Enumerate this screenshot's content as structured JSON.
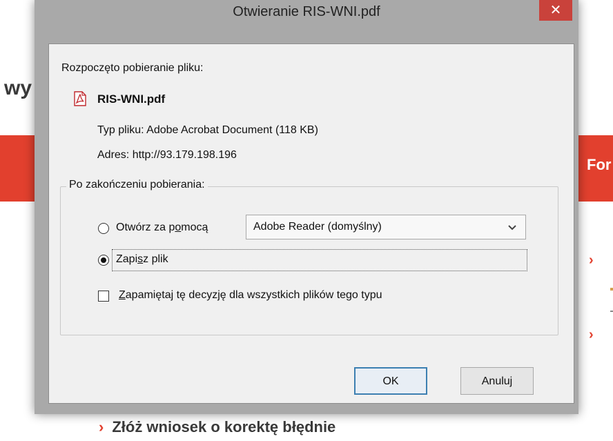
{
  "background": {
    "heading_fragment": "wy",
    "band_right_text": "For",
    "bullet_glyph": "›",
    "bottom_link": "Złóż wniosek o korektę błędnie"
  },
  "dialog": {
    "title": "Otwieranie RIS-WNI.pdf",
    "close_glyph": "✕",
    "started_label": "Rozpoczęto pobieranie pliku:",
    "file": {
      "icon": "pdf-file-icon",
      "name": "RIS-WNI.pdf",
      "type_label": "Typ pliku:",
      "type_value": "Adobe Acrobat Document (118 KB)",
      "address_label": "Adres:",
      "address_value": "http://93.179.198.196"
    },
    "after_download": {
      "legend": "Po zakończeniu pobierania:",
      "open_with": {
        "label_before": "Otwórz za p",
        "label_accel": "o",
        "label_after": "mocą",
        "selected": false,
        "app": "Adobe Reader  (domyślny)"
      },
      "save_file": {
        "label_before": "Zapi",
        "label_accel": "s",
        "label_after": "z plik",
        "selected": true
      },
      "remember": {
        "label_accel": "Z",
        "label_after": "apamiętaj tę decyzję dla wszystkich plików tego typu",
        "checked": false
      }
    },
    "buttons": {
      "ok": "OK",
      "cancel": "Anuluj"
    }
  },
  "colors": {
    "brand_red": "#e2402e",
    "close_red": "#c9423b",
    "dialog_frame": "#a9a9a9",
    "default_button_border": "#3c7fb1"
  }
}
